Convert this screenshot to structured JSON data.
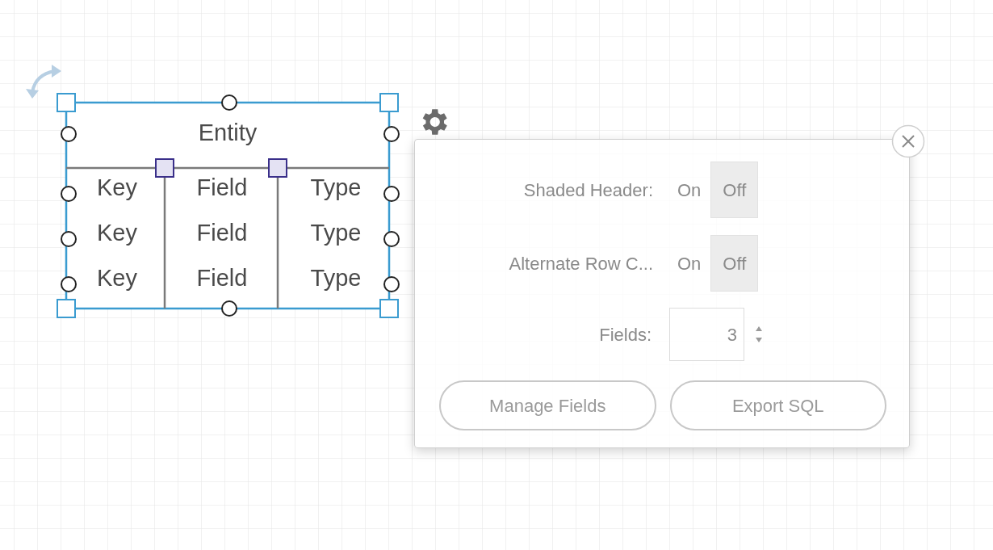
{
  "entity": {
    "title": "Entity",
    "rows": [
      {
        "key": "Key",
        "field": "Field",
        "type": "Type"
      },
      {
        "key": "Key",
        "field": "Field",
        "type": "Type"
      },
      {
        "key": "Key",
        "field": "Field",
        "type": "Type"
      }
    ]
  },
  "popover": {
    "toggles": [
      {
        "label": "Shaded Header:",
        "options": [
          {
            "label": "On",
            "selected": false
          },
          {
            "label": "Off",
            "selected": true
          }
        ]
      },
      {
        "label": "Alternate Row C...",
        "options": [
          {
            "label": "On",
            "selected": false
          },
          {
            "label": "Off",
            "selected": true
          }
        ]
      }
    ],
    "fields": {
      "label": "Fields:",
      "value": "3"
    },
    "buttons": [
      "Manage Fields",
      "Export SQL"
    ]
  }
}
